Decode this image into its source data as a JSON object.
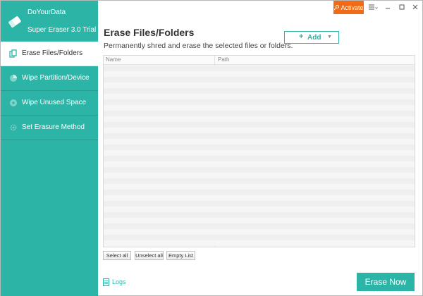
{
  "app": {
    "company": "DoYourData",
    "product": "Super Eraser 3.0 Trial"
  },
  "titlebar": {
    "activate_label": "Activate"
  },
  "sidebar": {
    "items": [
      {
        "label": "Erase Files/Folders",
        "icon": "files-icon",
        "active": true
      },
      {
        "label": "Wipe Partition/Device",
        "icon": "pie-chart-icon",
        "active": false
      },
      {
        "label": "Wipe Unused Space",
        "icon": "disk-icon",
        "active": false
      },
      {
        "label": "Set Erasure Method",
        "icon": "gear-icon",
        "active": false
      }
    ]
  },
  "main": {
    "title": "Erase Files/Folders",
    "subtitle": "Permanently shred and erase the selected files or folders.",
    "add_label": "Add",
    "table": {
      "columns": [
        "Name",
        "Path"
      ],
      "rows": []
    },
    "select_all_label": "Select all",
    "unselect_all_label": "Unselect all",
    "empty_list_label": "Empty List",
    "logs_label": "Logs",
    "erase_now_label": "Erase Now"
  },
  "colors": {
    "accent": "#2cb5a6",
    "activate": "#ef6b17"
  }
}
